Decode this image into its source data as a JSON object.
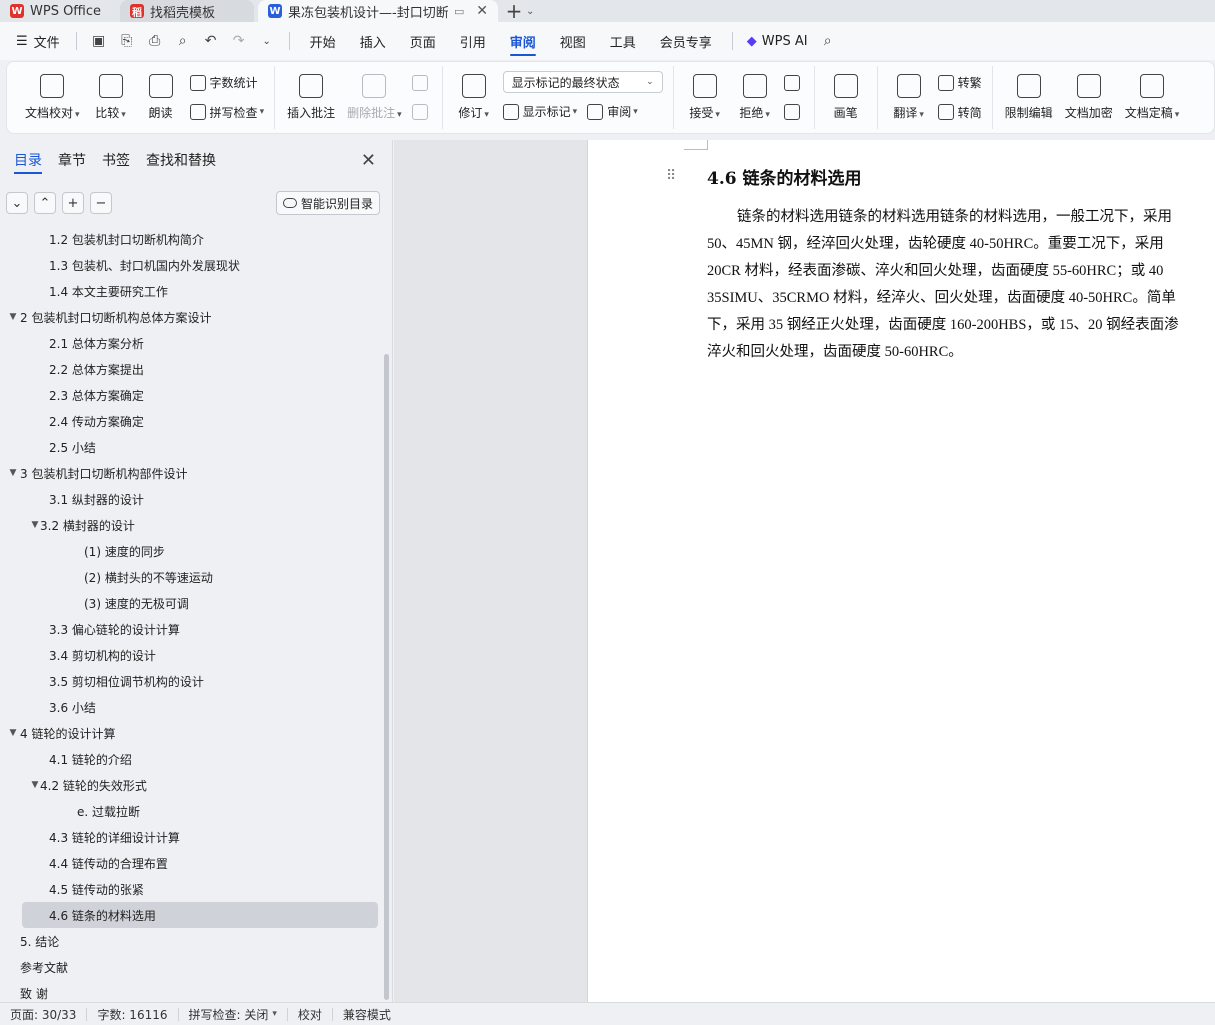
{
  "tabs": {
    "app": "WPS Office",
    "template": "找稻壳模板",
    "doc": "果冻包装机设计—-封口切断机"
  },
  "menu": {
    "file": "文件",
    "items": [
      "开始",
      "插入",
      "页面",
      "引用",
      "审阅",
      "视图",
      "工具",
      "会员专享"
    ],
    "active": "审阅",
    "ai": "WPS AI"
  },
  "ribbon": {
    "doc_check": "文档校对",
    "compare": "比较",
    "read_aloud": "朗读",
    "word_count": "字数统计",
    "spell_check": "拼写检查",
    "insert_comment": "插入批注",
    "delete_comment": "删除批注",
    "track": "修订",
    "markup_select": "显示标记的最终状态",
    "show_markup": "显示标记",
    "review": "审阅",
    "accept": "接受",
    "reject": "拒绝",
    "pen": "画笔",
    "translate": "翻译",
    "to_traditional": "转繁",
    "to_simplified": "转简",
    "restrict_edit": "限制编辑",
    "encrypt": "文档加密",
    "finalize": "文档定稿"
  },
  "sidebar": {
    "tabs": [
      "目录",
      "章节",
      "书签",
      "查找和替换"
    ],
    "smart_toc": "智能识别目录",
    "toc": [
      {
        "text": "1.2 包装机封口切断机构简介",
        "indent": 1,
        "arrow": ""
      },
      {
        "text": "1.3 包装机、封口机国内外发展现状",
        "indent": 1,
        "arrow": ""
      },
      {
        "text": "1.4 本文主要研究工作",
        "indent": 1,
        "arrow": ""
      },
      {
        "text": "2   包装机封口切断机构总体方案设计",
        "indent": 0,
        "arrow": "▼"
      },
      {
        "text": "2.1 总体方案分析",
        "indent": 1,
        "arrow": ""
      },
      {
        "text": "2.2 总体方案提出",
        "indent": 1,
        "arrow": ""
      },
      {
        "text": "2.3 总体方案确定",
        "indent": 1,
        "arrow": ""
      },
      {
        "text": "2.4 传动方案确定",
        "indent": 1,
        "arrow": ""
      },
      {
        "text": "2.5 小结",
        "indent": 1,
        "arrow": ""
      },
      {
        "text": "3   包装机封口切断机构部件设计",
        "indent": 0,
        "arrow": "▼"
      },
      {
        "text": "3.1 纵封器的设计",
        "indent": 1,
        "arrow": ""
      },
      {
        "text": "3.2 横封器的设计",
        "indent": 1,
        "arrow": "▼"
      },
      {
        "text": "(1)    速度的同步",
        "indent": 2,
        "arrow": ""
      },
      {
        "text": "(2)    横封头的不等速运动",
        "indent": 2,
        "arrow": ""
      },
      {
        "text": "(3)    速度的无极可调",
        "indent": 2,
        "arrow": ""
      },
      {
        "text": "3.3 偏心链轮的设计计算",
        "indent": 1,
        "arrow": ""
      },
      {
        "text": "3.4 剪切机构的设计",
        "indent": 1,
        "arrow": ""
      },
      {
        "text": "3.5  剪切相位调节机构的设计",
        "indent": 1,
        "arrow": ""
      },
      {
        "text": "3.6 小结",
        "indent": 1,
        "arrow": ""
      },
      {
        "text": "4   链轮的设计计算",
        "indent": 0,
        "arrow": "▼"
      },
      {
        "text": "4.1  链轮的介绍",
        "indent": 1,
        "arrow": ""
      },
      {
        "text": "4.2  链轮的失效形式",
        "indent": 1,
        "arrow": "▼"
      },
      {
        "text": "e. 过载拉断",
        "indent": 3,
        "arrow": ""
      },
      {
        "text": "4.3  链轮的详细设计计算",
        "indent": 1,
        "arrow": ""
      },
      {
        "text": "4.4  链传动的合理布置",
        "indent": 1,
        "arrow": ""
      },
      {
        "text": "4.5  链传动的张紧",
        "indent": 1,
        "arrow": ""
      },
      {
        "text": "4.6  链条的材料选用",
        "indent": 1,
        "arrow": "",
        "selected": true
      },
      {
        "text": "5. 结论",
        "indent": 0,
        "arrow": ""
      },
      {
        "text": "参考文献",
        "indent": 0,
        "arrow": ""
      },
      {
        "text": "致    谢",
        "indent": 0,
        "arrow": ""
      }
    ]
  },
  "document": {
    "heading": "4.6  链条的材料选用",
    "lines": [
      "链条的材料选用链条的材料选用链条的材料选用，一般工况下，采用",
      "50、45MN 钢，经淬回火处理，齿轮硬度 40-50HRC。重要工况下，采用",
      "20CR 材料，经表面渗碳、淬火和回火处理，齿面硬度 55-60HRC；或 40",
      "35SIMU、35CRMO 材料，经淬火、回火处理，齿面硬度 40-50HRC。简单",
      "下，采用 35 钢经正火处理，齿面硬度 160-200HBS，或 15、20 钢经表面渗",
      "淬火和回火处理，齿面硬度 50-60HRC。"
    ]
  },
  "status": {
    "page": "页面: 30/33",
    "words": "字数: 16116",
    "spell": "拼写检查: 关闭",
    "proof": "校对",
    "compat": "兼容模式"
  },
  "colors": {
    "accent": "#1a56d6",
    "wps_red": "#e0312b",
    "doc_blue": "#2b5fd9"
  }
}
